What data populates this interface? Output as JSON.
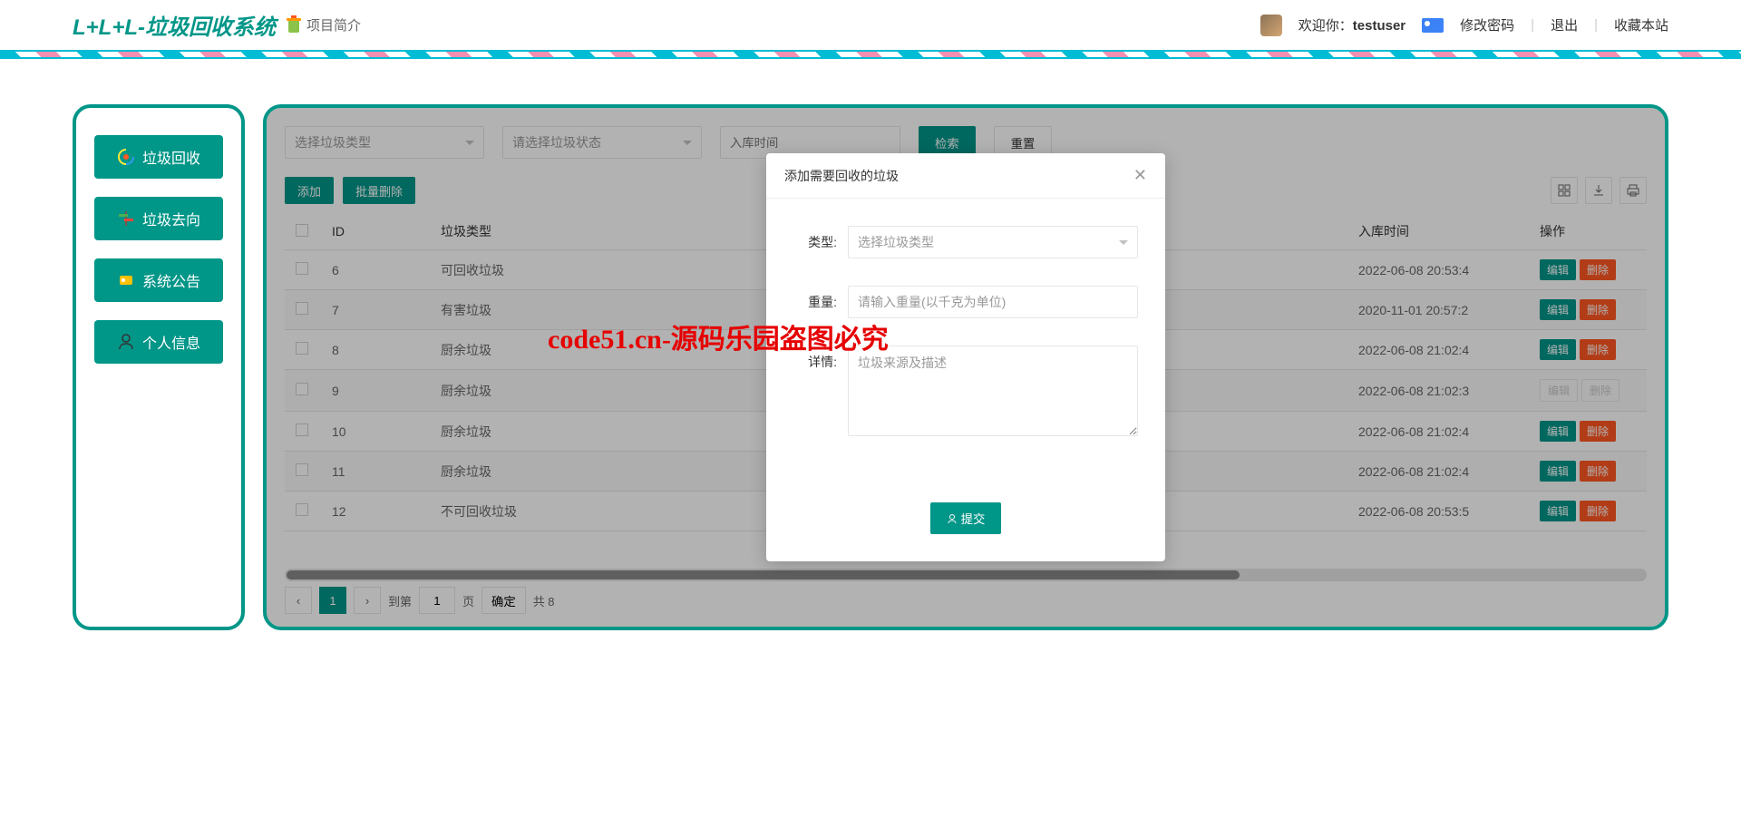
{
  "header": {
    "logo": "L+L+L-垃圾回收系统",
    "intro": "项目简介",
    "welcome_prefix": "欢迎你：",
    "username": "testuser",
    "change_pwd": "修改密码",
    "logout": "退出",
    "favorite": "收藏本站"
  },
  "sidebar": {
    "items": [
      {
        "label": "垃圾回收",
        "icon": "recycle-icon"
      },
      {
        "label": "垃圾去向",
        "icon": "direction-icon"
      },
      {
        "label": "系统公告",
        "icon": "announce-icon"
      },
      {
        "label": "个人信息",
        "icon": "person-icon"
      }
    ]
  },
  "filters": {
    "type_placeholder": "选择垃圾类型",
    "status_placeholder": "请选择垃圾状态",
    "time_placeholder": "入库时间",
    "search": "检索",
    "reset": "重置"
  },
  "actions": {
    "add": "添加",
    "batch_delete": "批量删除"
  },
  "table": {
    "headers": {
      "id": "ID",
      "type": "垃圾类型",
      "time": "入库时间",
      "ops": "操作"
    },
    "rows": [
      {
        "id": "6",
        "type": "可回收垃圾",
        "time": "2022-06-08 20:53:4",
        "disabled": false
      },
      {
        "id": "7",
        "type": "有害垃圾",
        "time": "2020-11-01 20:57:2",
        "disabled": false
      },
      {
        "id": "8",
        "type": "厨余垃圾",
        "time": "2022-06-08 21:02:4",
        "disabled": false
      },
      {
        "id": "9",
        "type": "厨余垃圾",
        "time": "2022-06-08 21:02:3",
        "disabled": true
      },
      {
        "id": "10",
        "type": "厨余垃圾",
        "time": "2022-06-08 21:02:4",
        "disabled": false
      },
      {
        "id": "11",
        "type": "厨余垃圾",
        "time": "2022-06-08 21:02:4",
        "disabled": false
      },
      {
        "id": "12",
        "type": "不可回收垃圾",
        "time": "2022-06-08 20:53:5",
        "disabled": false
      }
    ],
    "edit": "编辑",
    "delete": "删除"
  },
  "pager": {
    "current": "1",
    "goto_prefix": "到第",
    "goto_val": "1",
    "page_suffix": "页",
    "confirm": "确定",
    "total": "共 8"
  },
  "modal": {
    "title": "添加需要回收的垃圾",
    "type_label": "类型:",
    "type_placeholder": "选择垃圾类型",
    "weight_label": "重量:",
    "weight_placeholder": "请输入重量(以千克为单位)",
    "detail_label": "详情:",
    "detail_placeholder": "垃圾来源及描述",
    "submit": "提交"
  },
  "watermark": "code51.cn-源码乐园盗图必究"
}
